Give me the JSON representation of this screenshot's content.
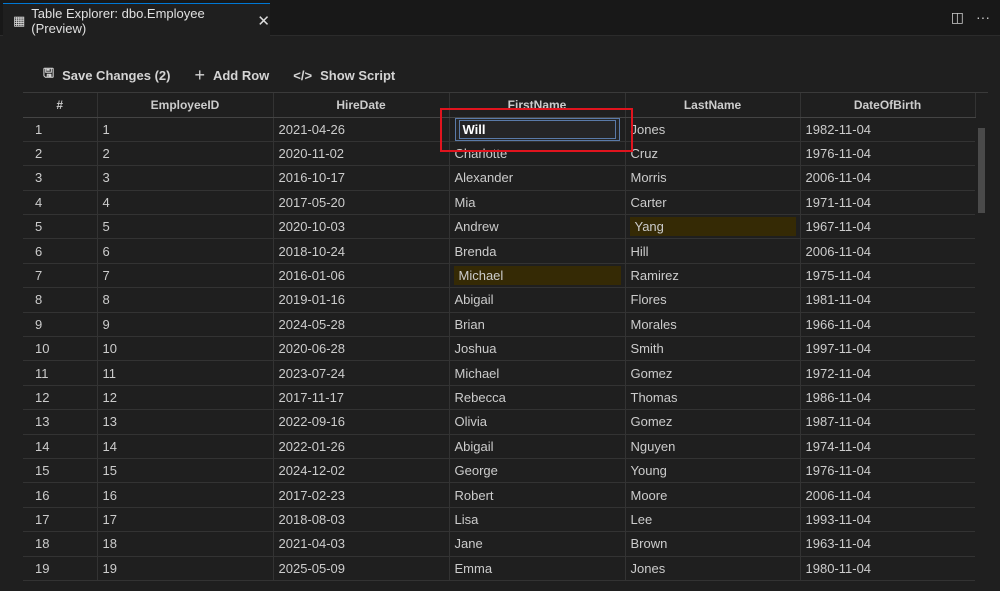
{
  "tab": {
    "title": "Table Explorer: dbo.Employee (Preview)",
    "icon": "table-edit-icon"
  },
  "toolbar": {
    "save": "Save Changes (2)",
    "add": "Add Row",
    "script": "Show Script"
  },
  "columns": [
    "#",
    "EmployeeID",
    "HireDate",
    "FirstName",
    "LastName",
    "DateOfBirth"
  ],
  "editing": {
    "row": 1,
    "column": "FirstName",
    "value": "Will"
  },
  "modified_cells": [
    {
      "row": 5,
      "column": "LastName"
    },
    {
      "row": 7,
      "column": "FirstName"
    }
  ],
  "rows": [
    [
      "1",
      "1",
      "2021-04-26",
      "Will",
      "Jones",
      "1982-11-04"
    ],
    [
      "2",
      "2",
      "2020-11-02",
      "Charlotte",
      "Cruz",
      "1976-11-04"
    ],
    [
      "3",
      "3",
      "2016-10-17",
      "Alexander",
      "Morris",
      "2006-11-04"
    ],
    [
      "4",
      "4",
      "2017-05-20",
      "Mia",
      "Carter",
      "1971-11-04"
    ],
    [
      "5",
      "5",
      "2020-10-03",
      "Andrew",
      "Yang",
      "1967-11-04"
    ],
    [
      "6",
      "6",
      "2018-10-24",
      "Brenda",
      "Hill",
      "2006-11-04"
    ],
    [
      "7",
      "7",
      "2016-01-06",
      "Michael",
      "Ramirez",
      "1975-11-04"
    ],
    [
      "8",
      "8",
      "2019-01-16",
      "Abigail",
      "Flores",
      "1981-11-04"
    ],
    [
      "9",
      "9",
      "2024-05-28",
      "Brian",
      "Morales",
      "1966-11-04"
    ],
    [
      "10",
      "10",
      "2020-06-28",
      "Joshua",
      "Smith",
      "1997-11-04"
    ],
    [
      "11",
      "11",
      "2023-07-24",
      "Michael",
      "Gomez",
      "1972-11-04"
    ],
    [
      "12",
      "12",
      "2017-11-17",
      "Rebecca",
      "Thomas",
      "1986-11-04"
    ],
    [
      "13",
      "13",
      "2022-09-16",
      "Olivia",
      "Gomez",
      "1987-11-04"
    ],
    [
      "14",
      "14",
      "2022-01-26",
      "Abigail",
      "Nguyen",
      "1974-11-04"
    ],
    [
      "15",
      "15",
      "2024-12-02",
      "George",
      "Young",
      "1976-11-04"
    ],
    [
      "16",
      "16",
      "2017-02-23",
      "Robert",
      "Moore",
      "2006-11-04"
    ],
    [
      "17",
      "17",
      "2018-08-03",
      "Lisa",
      "Lee",
      "1993-11-04"
    ],
    [
      "18",
      "18",
      "2021-04-03",
      "Jane",
      "Brown",
      "1963-11-04"
    ],
    [
      "19",
      "19",
      "2025-05-09",
      "Emma",
      "Jones",
      "1980-11-04"
    ]
  ]
}
